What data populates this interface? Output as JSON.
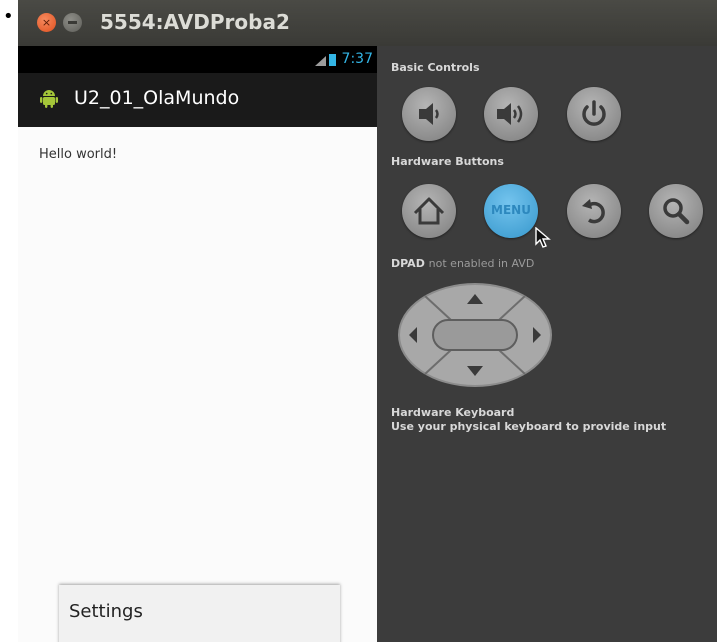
{
  "page": {
    "bullet": "•"
  },
  "window": {
    "title": "5554:AVDProba2",
    "close_glyph": "×"
  },
  "device": {
    "clock": "7:37",
    "app_title": "U2_01_OlaMundo",
    "content_text": "Hello world!",
    "menu_item": "Settings"
  },
  "controls": {
    "basic_header": "Basic Controls",
    "hardware_header": "Hardware Buttons",
    "menu_label": "MENU",
    "dpad_header_1": "DPAD",
    "dpad_header_2": "not enabled in AVD",
    "keyboard_header": "Hardware Keyboard",
    "keyboard_text": "Use your physical keyboard to provide input"
  },
  "colors": {
    "accent": "#33b5e5",
    "menu_button": "#3697cc",
    "panel_bg": "#3c3c3c",
    "close_button": "#e0501f"
  },
  "icons": [
    "volume-down-icon",
    "volume-up-icon",
    "power-icon",
    "home-icon",
    "back-icon",
    "search-icon",
    "android-icon",
    "signal-icon",
    "battery-icon",
    "mouse-cursor-icon"
  ]
}
